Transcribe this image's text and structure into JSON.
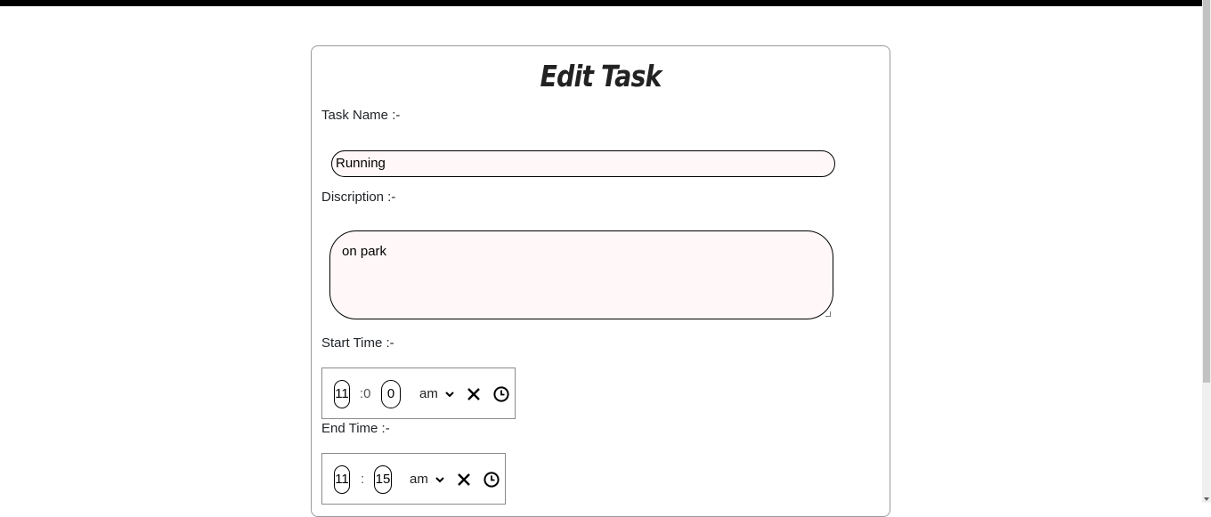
{
  "form": {
    "title": "Edit Task",
    "task_name_label": "Task Name :-",
    "task_name_value": "Running",
    "description_label": "Discription :-",
    "description_value": "on park",
    "start_time_label": "Start Time :-",
    "end_time_label": "End Time :-"
  },
  "start_time": {
    "hour": "11",
    "separator": ":0",
    "minute": "0",
    "period": "am"
  },
  "end_time": {
    "hour": "11",
    "separator": ":",
    "minute": "15",
    "period": "am"
  },
  "icons": {
    "clear": "close-icon",
    "clock": "clock-icon",
    "dropdown": "chevron-down-icon"
  }
}
